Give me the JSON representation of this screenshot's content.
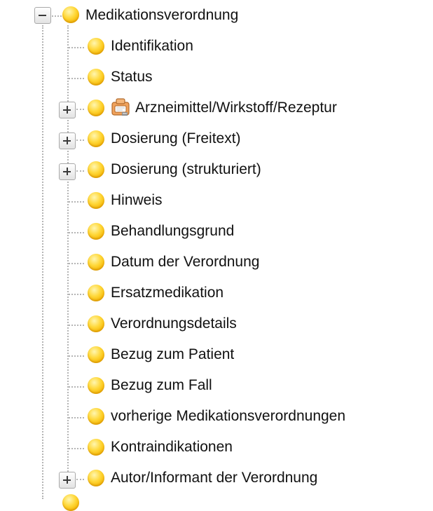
{
  "tree": {
    "root": {
      "label": "Medikationsverordnung",
      "expanded": true,
      "toggle_icon": "collapse-minus-icon",
      "node_icon": "yellow-bullet-icon"
    },
    "children": [
      {
        "label": "Identifikation",
        "expandable": false,
        "node_icon": "yellow-bullet-icon"
      },
      {
        "label": "Status",
        "expandable": false,
        "node_icon": "yellow-bullet-icon"
      },
      {
        "label": "Arzneimittel/Wirkstoff/Rezeptur",
        "expandable": true,
        "node_icon": "yellow-bullet-icon",
        "extra_icon": "package-reference-icon"
      },
      {
        "label": "Dosierung (Freitext)",
        "expandable": true,
        "node_icon": "yellow-bullet-icon"
      },
      {
        "label": "Dosierung (strukturiert)",
        "expandable": true,
        "node_icon": "yellow-bullet-icon"
      },
      {
        "label": "Hinweis",
        "expandable": false,
        "node_icon": "yellow-bullet-icon"
      },
      {
        "label": "Behandlungsgrund",
        "expandable": false,
        "node_icon": "yellow-bullet-icon"
      },
      {
        "label": "Datum der Verordnung",
        "expandable": false,
        "node_icon": "yellow-bullet-icon"
      },
      {
        "label": "Ersatzmedikation",
        "expandable": false,
        "node_icon": "yellow-bullet-icon"
      },
      {
        "label": "Verordnungsdetails",
        "expandable": false,
        "node_icon": "yellow-bullet-icon"
      },
      {
        "label": "Bezug zum Patient",
        "expandable": false,
        "node_icon": "yellow-bullet-icon"
      },
      {
        "label": "Bezug zum Fall",
        "expandable": false,
        "node_icon": "yellow-bullet-icon"
      },
      {
        "label": "vorherige Medikationsverordnungen",
        "expandable": false,
        "node_icon": "yellow-bullet-icon"
      },
      {
        "label": "Kontraindikationen",
        "expandable": false,
        "node_icon": "yellow-bullet-icon"
      },
      {
        "label": "Autor/Informant der Verordnung",
        "expandable": true,
        "node_icon": "yellow-bullet-icon"
      }
    ]
  },
  "colors": {
    "bullet": "#f5b400",
    "guide_lines": "#b5b5b5",
    "text": "#111111"
  }
}
